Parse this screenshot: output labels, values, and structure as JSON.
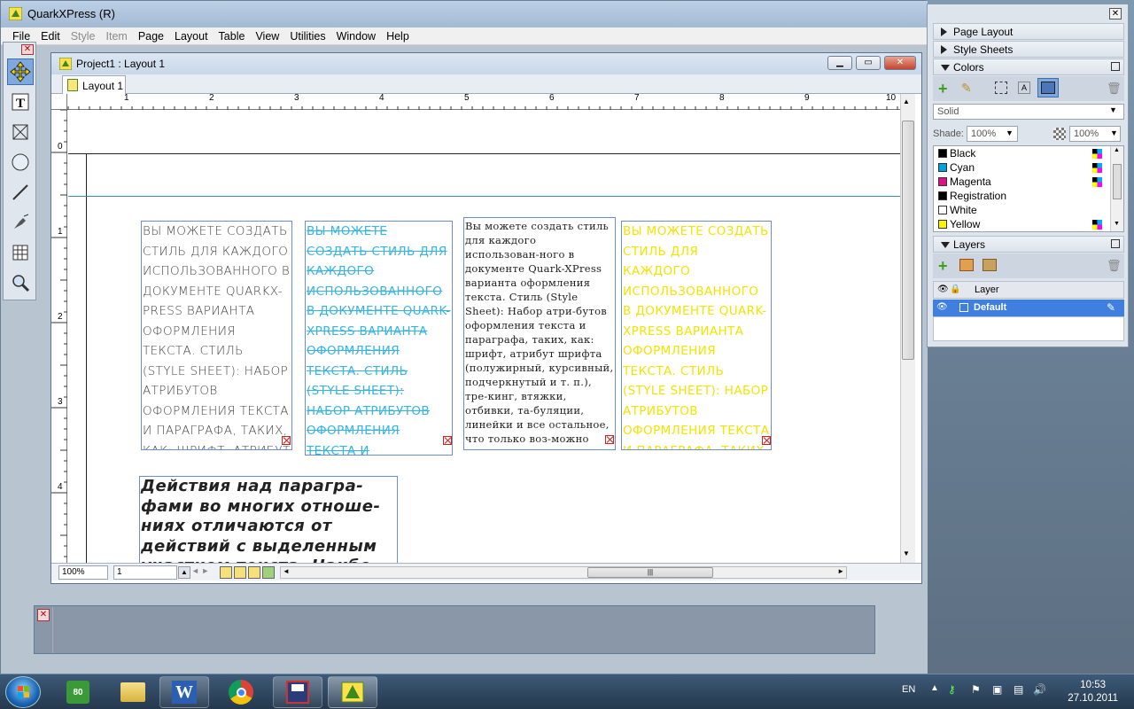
{
  "app": {
    "title": "QuarkXPress (R)"
  },
  "menu": [
    "File",
    "Edit",
    "Style",
    "Item",
    "Page",
    "Layout",
    "Table",
    "View",
    "Utilities",
    "Window",
    "Help"
  ],
  "menu_disabled": [
    "Style",
    "Item"
  ],
  "document": {
    "title": "Project1 : Layout 1",
    "tab": "Layout 1",
    "ruler_h": [
      "1",
      "2",
      "3",
      "4",
      "5",
      "6",
      "7",
      "8",
      "9",
      "10"
    ],
    "ruler_v": [
      "0",
      "1",
      "2",
      "3",
      "4"
    ],
    "zoom": "100%",
    "page": "1"
  },
  "textboxes": {
    "box1": "ВЫ МОЖЕТЕ СОЗДАТЬ СТИЛЬ ДЛЯ КАЖДОГО ИСПОЛЬЗОВАННОГО В ДОКУМЕНТЕ QUARKX-PRESS ВАРИАНТА ОФОРМЛЕНИЯ ТЕКСТА. СТИЛЬ (STYLE SHEET): НАБОР АТРИБУТОВ ОФОРМЛЕНИЯ ТЕКСТА И ПАРАГРАФА, ТАКИХ, КАК: ШРИФТ, АТРИБУТ",
    "box2": "ВЫ МОЖЕТЕ СОЗДАТЬ СТИЛЬ ДЛЯ КАЖДОГО ИСПОЛЬЗОВАННОГО В ДОКУМЕНТЕ QUARK-XPRESS ВАРИАНТА ОФОРМЛЕНИЯ ТЕКСТА. СТИЛЬ (STYLE SHEET): НАБОР АТРИБУТОВ ОФОРМЛЕНИЯ ТЕКСТА И ПАРАГРАФА, ТАКИХ, КАК: ШРИФТ, АТРИБУТ",
    "box3": "Вы можете создать стиль для каждого использован-ного в документе Quark-XPress варианта оформления текста. Стиль (Style Sheet): Набор атри-бутов оформления текста и параграфа, таких, как: шрифт, атрибут шрифта (полужирный, курсивный, подчеркнутый и т. п.), тре-кинг, втяжки, отбивки, та-буляции, линейки и все остальное, что только воз-можно применить в каче-стве атрибута оформлени",
    "box4": "ВЫ МОЖЕТЕ СОЗДАТЬ СТИЛЬ ДЛЯ КАЖДОГО ИСПОЛЬЗОВАННОГО В ДОКУМЕНТЕ QUARK-XPRESS ВАРИАНТА ОФОРМЛЕНИЯ ТЕКСТА. СТИЛЬ (STYLE SHEET): НАБОР АТРИБУТОВ ОФОРМЛЕНИЯ ТЕКСТА И ПАРАГРАФА, ТАКИХ, КАК: ШРИФТ, АТРИБУТ",
    "box5": "Действия над парагра-фами во многих отноше-ниях отличаются от действий с выделенным участком текста. Наибо-"
  },
  "palettes": {
    "page_layout": "Page Layout",
    "style_sheets": "Style Sheets",
    "colors": "Colors",
    "fill_style": "Solid",
    "shade_label": "Shade:",
    "shade_value": "100%",
    "opacity_value": "100%",
    "color_list": [
      {
        "name": "Black",
        "color": "#000000"
      },
      {
        "name": "Cyan",
        "color": "#00a0e0"
      },
      {
        "name": "Magenta",
        "color": "#e0108a"
      },
      {
        "name": "Registration",
        "color": "#000000"
      },
      {
        "name": "White",
        "color": "#ffffff"
      },
      {
        "name": "Yellow",
        "color": "#fff200"
      }
    ],
    "layers": "Layers",
    "layer_header": "Layer",
    "layer_default": "Default"
  },
  "taskbar": {
    "lang": "EN",
    "time": "10:53",
    "date": "27.10.2011"
  },
  "colors": {
    "accent": "#3f7fe0",
    "yellow_text": "#f2e400",
    "cyan_text": "#36b4e6"
  }
}
